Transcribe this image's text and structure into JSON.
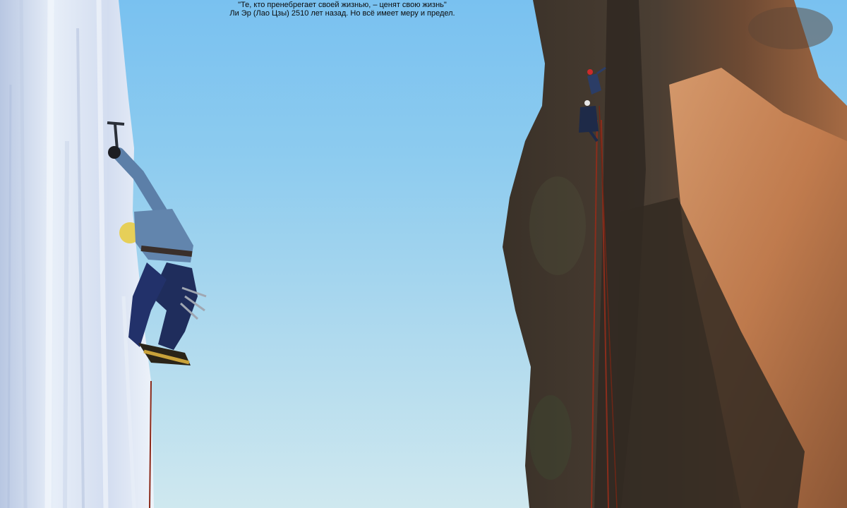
{
  "caption": {
    "quote": "\"Те, кто пренебрегает своей жизнью, – ценят свою жизнь\"",
    "attribution": "Ли Эр (Лао Цзы) 2510 лет назад. Но всё имеет меру и предел."
  },
  "scene": {
    "left": "ice climber with ice axe and crampons on a frozen waterfall",
    "right": "two rock climbers on ropes on a granite tower",
    "background": "clear blue sky"
  },
  "colors": {
    "sky_top": "#79c1f0",
    "sky_bottom": "#cfe8ef",
    "ice": "#dde8f5",
    "rock_shadow": "#3d342b",
    "rock_lit": "#c47a4a"
  }
}
